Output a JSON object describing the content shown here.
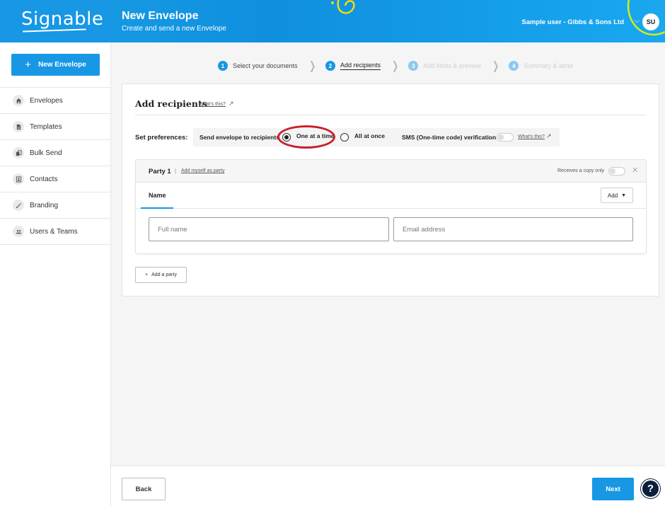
{
  "app": {
    "logo": "Signable"
  },
  "header": {
    "title": "New Envelope",
    "subtitle": "Create and send a new Envelope",
    "user": "Sample user - Gibbs & Sons Ltd",
    "avatar_initials": "SU"
  },
  "sidebar": {
    "new_button": "New Envelope",
    "items": [
      {
        "label": "Envelopes",
        "icon": "home-icon"
      },
      {
        "label": "Templates",
        "icon": "document-icon"
      },
      {
        "label": "Bulk Send",
        "icon": "copy-icon"
      },
      {
        "label": "Contacts",
        "icon": "contact-card-icon"
      },
      {
        "label": "Branding",
        "icon": "brush-icon"
      },
      {
        "label": "Users & Teams",
        "icon": "users-icon"
      }
    ]
  },
  "stepper": {
    "steps": [
      {
        "num": "1",
        "label": "Select your documents",
        "state": "done"
      },
      {
        "num": "2",
        "label": "Add recipients",
        "state": "active"
      },
      {
        "num": "3",
        "label": "Add fields & preview",
        "state": "disabled"
      },
      {
        "num": "4",
        "label": "Summary & send",
        "state": "disabled"
      }
    ]
  },
  "recipients": {
    "title": "Add recipients",
    "whats_this": "What's this?",
    "prefs_label": "Set preferences:",
    "send_label": "Send envelope to recipients",
    "option_one": "One at a time",
    "option_all": "All at once",
    "selected_option": "One at a time",
    "sms_label": "SMS (One-time code) verification",
    "sms_whats_this": "What's this?"
  },
  "party": {
    "name": "Party 1",
    "separator": "|",
    "add_myself": "Add myself as party",
    "receives_copy": "Receives a copy only",
    "tab_name": "Name",
    "add_button": "Add",
    "full_name_placeholder": "Full name",
    "email_placeholder": "Email address",
    "add_party": "Add a party"
  },
  "footer": {
    "back": "Back",
    "next": "Next",
    "help": "?"
  },
  "colors": {
    "brand_blue": "#1797e4",
    "highlight_red": "#c8202a",
    "help_navy": "#0b1f3a"
  }
}
